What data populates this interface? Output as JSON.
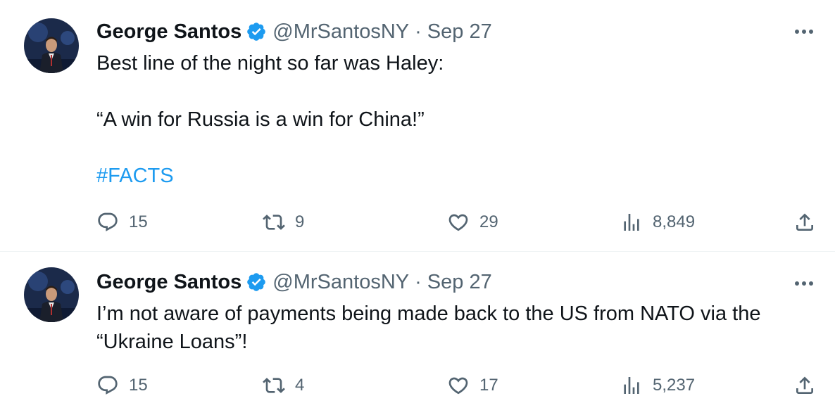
{
  "tweets": [
    {
      "author": {
        "name": "George Santos",
        "handle": "@MrSantosNY",
        "verified": true
      },
      "separator": "·",
      "date": "Sep 27",
      "text_lines": [
        "Best line of the night so far was Haley:",
        "",
        "“A win for Russia is a win for China!”",
        ""
      ],
      "hashtag": "#FACTS",
      "stats": {
        "replies": "15",
        "retweets": "9",
        "likes": "29",
        "views": "8,849"
      }
    },
    {
      "author": {
        "name": "George Santos",
        "handle": "@MrSantosNY",
        "verified": true
      },
      "separator": "·",
      "date": "Sep 27",
      "text_lines": [
        "I’m not aware of payments being made back to the US from NATO via the",
        "“Ukraine Loans”!"
      ],
      "stats": {
        "replies": "15",
        "retweets": "4",
        "likes": "17",
        "views": "5,237"
      }
    }
  ],
  "icons": {
    "reply": "speech-bubble-icon",
    "retweet": "retweet-arrows-icon",
    "like": "heart-icon",
    "views": "bar-chart-icon",
    "share": "share-upload-icon",
    "more": "ellipsis-icon",
    "verified": "verified-badge-icon"
  },
  "colors": {
    "accent": "#1d9bf0",
    "secondary_text": "#536471",
    "primary_text": "#0f1419"
  }
}
